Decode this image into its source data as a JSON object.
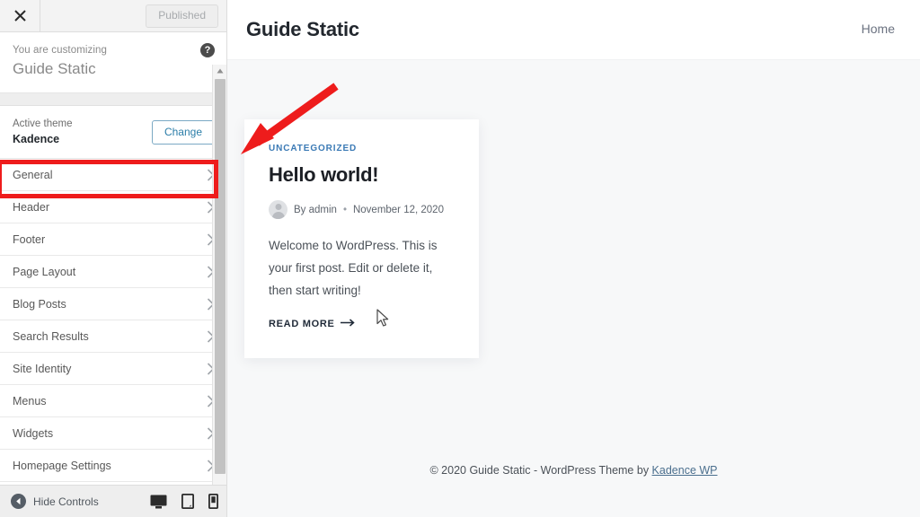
{
  "customizer": {
    "topbar": {
      "close_icon": "close-icon",
      "publish_label": "Published"
    },
    "info": {
      "eyebrow": "You are customizing",
      "site_name": "Guide Static",
      "help_icon": "help-icon",
      "help_glyph": "?"
    },
    "theme": {
      "label": "Active theme",
      "name": "Kadence",
      "change_label": "Change"
    },
    "items": [
      {
        "label": "General"
      },
      {
        "label": "Header"
      },
      {
        "label": "Footer"
      },
      {
        "label": "Page Layout"
      },
      {
        "label": "Blog Posts"
      },
      {
        "label": "Search Results"
      },
      {
        "label": "Site Identity"
      },
      {
        "label": "Menus"
      },
      {
        "label": "Widgets"
      },
      {
        "label": "Homepage Settings"
      }
    ],
    "bottombar": {
      "hide_controls_label": "Hide Controls",
      "devices": [
        {
          "name": "desktop-preview-icon"
        },
        {
          "name": "tablet-preview-icon"
        },
        {
          "name": "mobile-preview-icon"
        }
      ]
    }
  },
  "preview": {
    "header": {
      "site_title": "Guide Static",
      "nav": [
        {
          "label": "Home"
        }
      ]
    },
    "post": {
      "category": "UNCATEGORIZED",
      "title": "Hello world!",
      "byline_author": "By admin",
      "byline_separator": "•",
      "byline_date": "November 12, 2020",
      "excerpt": "Welcome to WordPress. This is your first post. Edit or delete it, then start writing!",
      "read_more": "READ MORE",
      "read_more_arrow": "→"
    },
    "footer": {
      "text": "© 2020 Guide Static - WordPress Theme by ",
      "link": "Kadence WP"
    }
  },
  "annotations": {
    "highlight_color": "#ee1c1c",
    "highlight_target": "General",
    "arrow_color": "#ee1c1c"
  }
}
